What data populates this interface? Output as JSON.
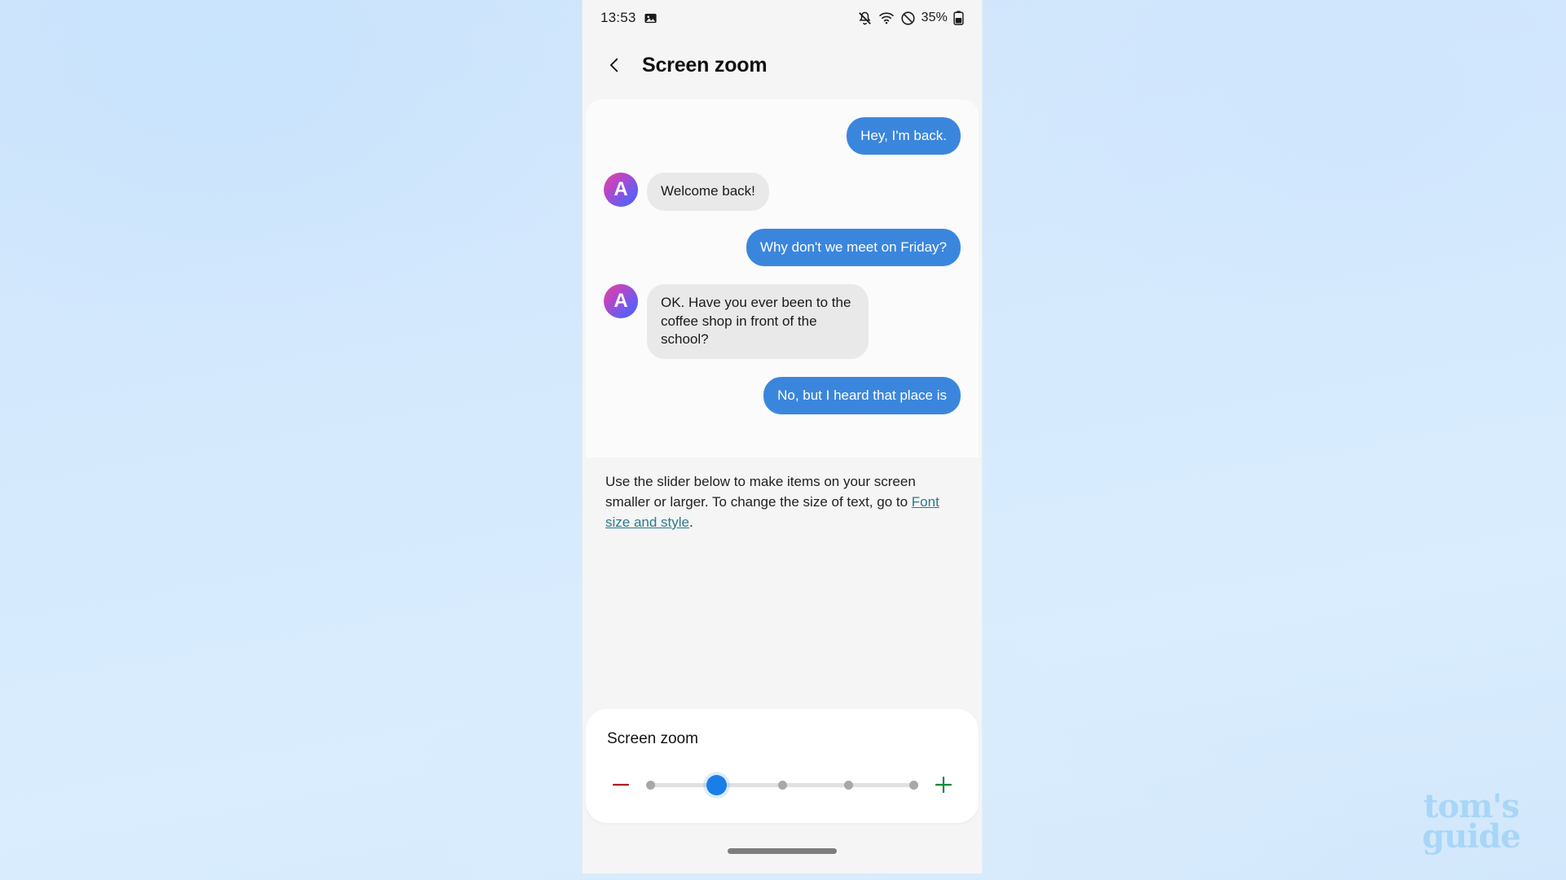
{
  "statusbar": {
    "time": "13:53",
    "icons": [
      "image-icon",
      "mute-icon",
      "wifi-icon",
      "do-not-disturb-icon"
    ],
    "battery_percent": "35%"
  },
  "appbar": {
    "back_label": "back-arrow",
    "title": "Screen zoom"
  },
  "chat_preview": {
    "avatar_letter": "A",
    "messages": [
      {
        "side": "out",
        "text": "Hey, I'm back."
      },
      {
        "side": "in",
        "text": "Welcome back!"
      },
      {
        "side": "out",
        "text": "Why don't we meet on Friday?"
      },
      {
        "side": "in",
        "text": "OK. Have you ever been to the coffee shop in front of the school?"
      },
      {
        "side": "out",
        "text": "No, but I heard that place is"
      }
    ]
  },
  "description": {
    "text_before": "Use the slider below to make items on your screen smaller or larger. To change the size of text, go to ",
    "link_text": "Font size and style",
    "text_after": "."
  },
  "slider_card": {
    "title": "Screen zoom",
    "minus_label": "minus-icon",
    "plus_label": "plus-icon",
    "steps": 5,
    "current_index": 1
  },
  "navbar": {
    "gesture_pill": "home-gesture-pill"
  },
  "watermark": {
    "line1": "tom's",
    "line2": "guide"
  },
  "colors": {
    "accent_blue": "#1a7ee8",
    "bubble_out": "#3b86dd",
    "bubble_in": "#e9e9e9",
    "link": "#2a7b8c",
    "minus": "#b01c1c",
    "plus": "#0f8a3c",
    "watermark": "#a8d6f7"
  }
}
